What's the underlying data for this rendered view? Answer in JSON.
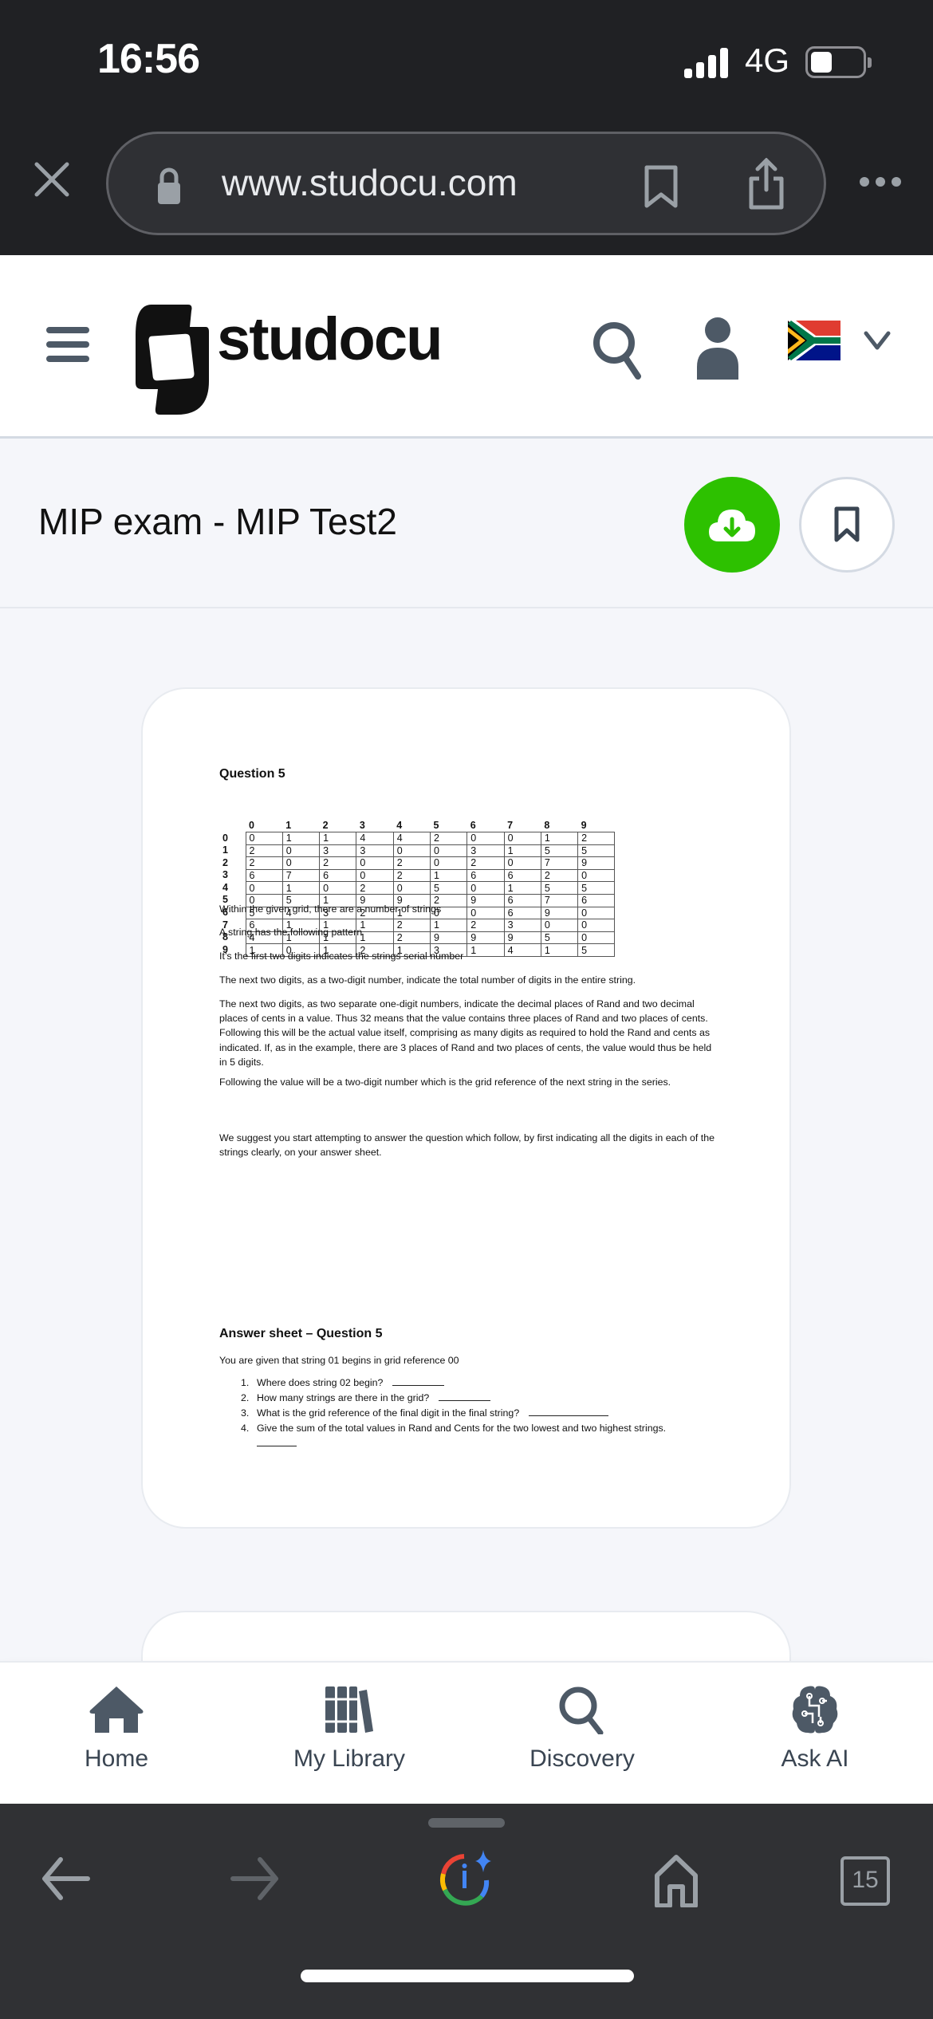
{
  "status_bar": {
    "time": "16:56",
    "network": "4G",
    "signal_bars": 4,
    "battery_level_percent": 40
  },
  "browser": {
    "url": "www.studocu.com",
    "open_tabs_count": "15"
  },
  "site_header": {
    "logo_text": "studocu",
    "country_flag": "South Africa"
  },
  "document": {
    "title": "MIP exam - MIP Test2",
    "brand_green": "#2dc100",
    "question_heading": "Question 5",
    "grid": {
      "column_headers": [
        "0",
        "1",
        "2",
        "3",
        "4",
        "5",
        "6",
        "7",
        "8",
        "9"
      ],
      "rows": [
        {
          "label": "0",
          "cells": [
            "0",
            "1",
            "1",
            "4",
            "4",
            "2",
            "0",
            "0",
            "1",
            "2"
          ]
        },
        {
          "label": "1",
          "cells": [
            "2",
            "0",
            "3",
            "3",
            "0",
            "0",
            "3",
            "1",
            "5",
            "5"
          ]
        },
        {
          "label": "2",
          "cells": [
            "2",
            "0",
            "2",
            "0",
            "2",
            "0",
            "2",
            "0",
            "7",
            "9"
          ]
        },
        {
          "label": "3",
          "cells": [
            "6",
            "7",
            "6",
            "0",
            "2",
            "1",
            "6",
            "6",
            "2",
            "0"
          ]
        },
        {
          "label": "4",
          "cells": [
            "0",
            "1",
            "0",
            "2",
            "0",
            "5",
            "0",
            "1",
            "5",
            "5"
          ]
        },
        {
          "label": "5",
          "cells": [
            "0",
            "5",
            "1",
            "9",
            "9",
            "2",
            "9",
            "6",
            "7",
            "6"
          ]
        },
        {
          "label": "6",
          "cells": [
            "5",
            "4",
            "3",
            "2",
            "1",
            "0",
            "0",
            "6",
            "9",
            "0"
          ]
        },
        {
          "label": "7",
          "cells": [
            "6",
            "1",
            "1",
            "1",
            "2",
            "1",
            "2",
            "3",
            "0",
            "0"
          ]
        },
        {
          "label": "8",
          "cells": [
            "4",
            "1",
            "1",
            "1",
            "2",
            "9",
            "9",
            "9",
            "5",
            "0"
          ]
        },
        {
          "label": "9",
          "cells": [
            "1",
            "0",
            "1",
            "2",
            "1",
            "3",
            "1",
            "4",
            "1",
            "5"
          ]
        }
      ]
    },
    "paragraphs": [
      "Within the given grid, there are a number of strings",
      "A string has the following pattern",
      "It’s the first two digits indicates the strings serial number",
      "The next two digits, as a two-digit number, indicate the total number of digits in the entire string.",
      "The next two digits, as two separate one-digit numbers, indicate the decimal places of Rand and two decimal places of cents in a value. Thus 32 means that the value contains three places of Rand and two places of cents. Following this will be the actual value itself, comprising as many digits as required to hold the Rand and cents as indicated. If, as in the example, there are 3 places of Rand and two places of cents, the value would thus be held in 5 digits.",
      "Following the value will be a two-digit number which is the grid reference of the next string in the series.",
      "We suggest you start attempting to answer the question which follow, by first indicating all the digits in each of the strings clearly, on your answer sheet."
    ],
    "answer_sheet": {
      "heading": "Answer sheet – Question 5",
      "given": "You are given that string 01 begins in grid reference 00",
      "questions": [
        {
          "num": "1.",
          "text": "Where does string 02 begin?"
        },
        {
          "num": "2.",
          "text": "How many strings are there in the grid?"
        },
        {
          "num": "3.",
          "text": "What is the grid reference of the final digit in the final string?"
        },
        {
          "num": "4.",
          "text": "Give the sum of the total values in Rand and Cents for the two lowest and two highest strings."
        }
      ]
    }
  },
  "bottom_nav": {
    "items": [
      {
        "label": "Home",
        "icon": "home-icon"
      },
      {
        "label": "My Library",
        "icon": "library-icon"
      },
      {
        "label": "Discovery",
        "icon": "search-icon"
      },
      {
        "label": "Ask AI",
        "icon": "brain-icon"
      }
    ]
  }
}
